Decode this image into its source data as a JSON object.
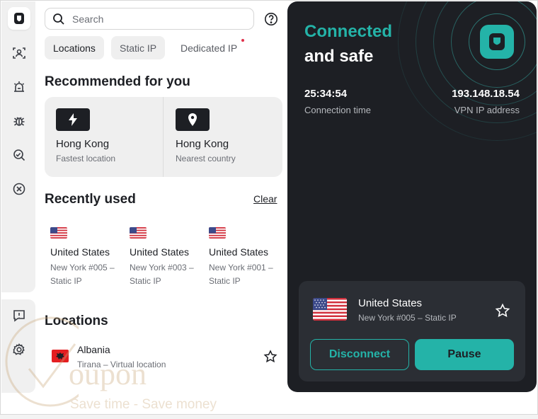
{
  "search": {
    "placeholder": "Search"
  },
  "tabs": [
    {
      "label": "Locations"
    },
    {
      "label": "Static IP"
    },
    {
      "label": "Dedicated IP"
    }
  ],
  "recommended": {
    "heading": "Recommended for you",
    "items": [
      {
        "name": "Hong Kong",
        "sub": "Fastest location",
        "icon": "lightning-icon"
      },
      {
        "name": "Hong Kong",
        "sub": "Nearest country",
        "icon": "location-pin-icon"
      }
    ]
  },
  "recent": {
    "heading": "Recently used",
    "clear_label": "Clear",
    "items": [
      {
        "name": "United States",
        "sub1": "New York #005 –",
        "sub2": "Static IP"
      },
      {
        "name": "United States",
        "sub1": "New York #003 –",
        "sub2": "Static IP"
      },
      {
        "name": "United States",
        "sub1": "New York #001 –",
        "sub2": "Static IP"
      }
    ]
  },
  "locations": {
    "heading": "Locations",
    "items": [
      {
        "name": "Albania",
        "sub": "Tirana – Virtual location"
      }
    ]
  },
  "watermark": {
    "brand": "oupon",
    "tagline": "Save time - Save money"
  },
  "status": {
    "line1": "Connected",
    "line2": "and safe",
    "time_value": "25:34:54",
    "time_label": "Connection time",
    "ip_value": "193.148.18.54",
    "ip_label": "VPN IP address"
  },
  "connection": {
    "name": "United States",
    "sub": "New York #005 – Static IP",
    "disconnect_label": "Disconnect",
    "pause_label": "Pause"
  },
  "colors": {
    "accent": "#24b3a8",
    "panel": "#1d1f24",
    "card": "#2b2e34",
    "notify_dot": "#e0314b"
  },
  "rail_icons": [
    "shield-icon",
    "user-scan-icon",
    "alarm-icon",
    "bug-icon",
    "search-web-icon",
    "block-icon",
    "feedback-icon",
    "settings-icon"
  ]
}
